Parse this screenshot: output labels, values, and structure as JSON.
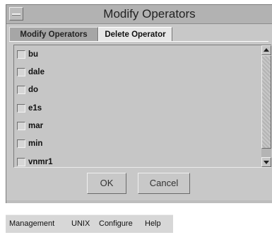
{
  "dialog": {
    "title": "Modify Operators",
    "tabs": [
      {
        "label": "Modify Operators",
        "active": false
      },
      {
        "label": "Delete Operator",
        "active": true
      }
    ],
    "operators": [
      {
        "label": "bu",
        "checked": false
      },
      {
        "label": "dale",
        "checked": false
      },
      {
        "label": "do",
        "checked": false
      },
      {
        "label": "e1s",
        "checked": false
      },
      {
        "label": "mar",
        "checked": false
      },
      {
        "label": "min",
        "checked": false
      },
      {
        "label": "vnmr1",
        "checked": false
      }
    ],
    "buttons": {
      "ok_label": "OK",
      "cancel_label": "Cancel"
    }
  },
  "menubar": {
    "items": [
      {
        "label": "Management"
      },
      {
        "label": "UNIX"
      },
      {
        "label": "Configure"
      },
      {
        "label": "Help"
      }
    ]
  }
}
